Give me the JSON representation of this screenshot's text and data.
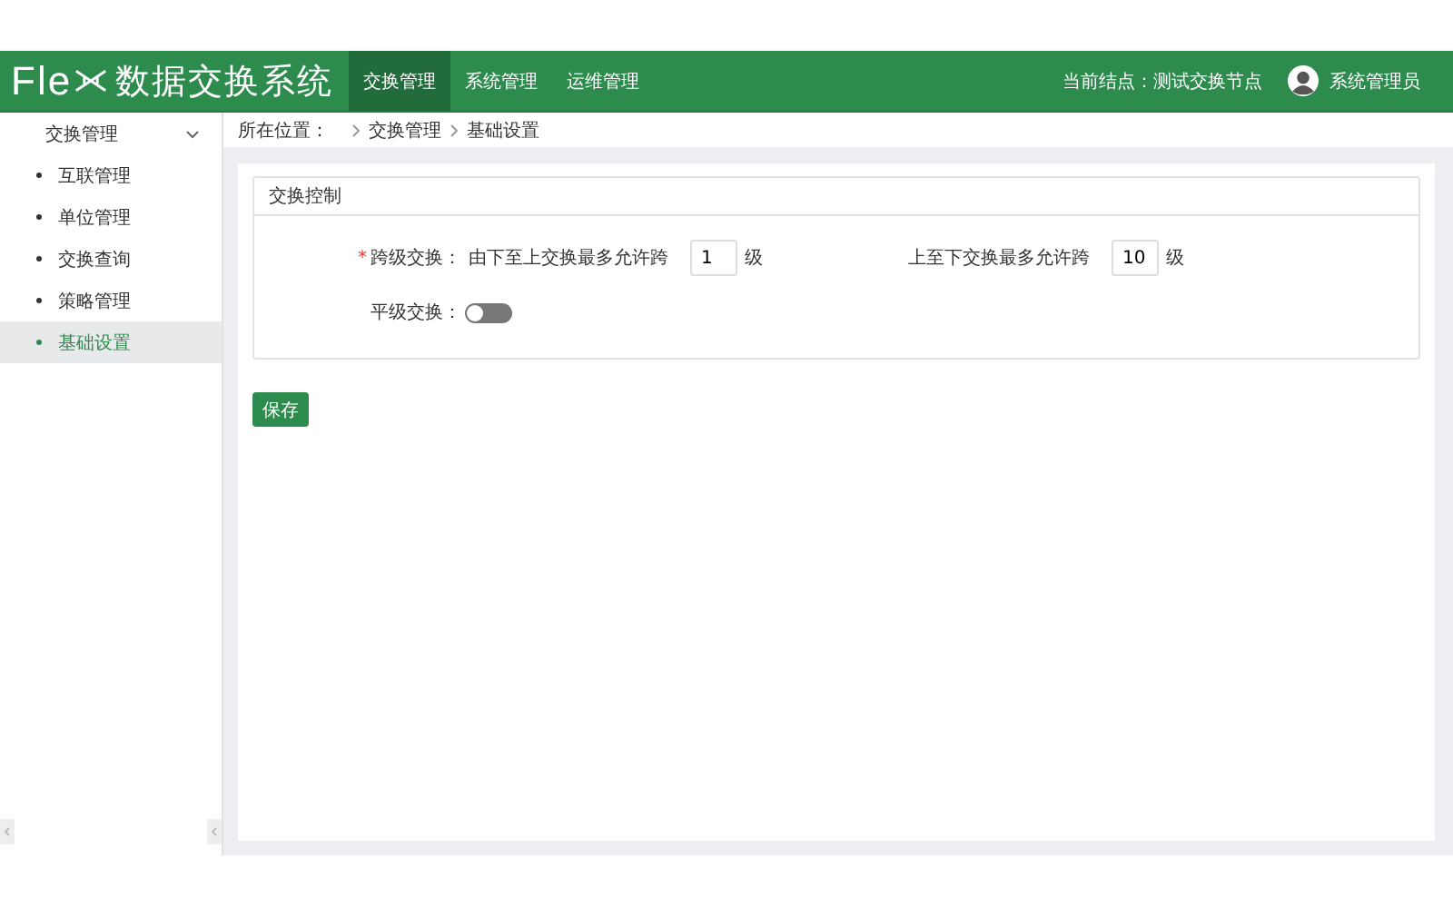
{
  "header": {
    "logo_text": "Fle",
    "system_name": "数据交换系统",
    "nav": [
      {
        "label": "交换管理",
        "selected": true
      },
      {
        "label": "系统管理",
        "selected": false
      },
      {
        "label": "运维管理",
        "selected": false
      }
    ],
    "node_label": "当前结点：测试交换节点",
    "user": "系统管理员"
  },
  "sidebar": {
    "group": {
      "label": "交换管理",
      "expanded": true
    },
    "items": [
      {
        "label": "互联管理",
        "selected": false
      },
      {
        "label": "单位管理",
        "selected": false
      },
      {
        "label": "交换查询",
        "selected": false
      },
      {
        "label": "策略管理",
        "selected": false
      },
      {
        "label": "基础设置",
        "selected": true
      }
    ]
  },
  "breadcrumb": {
    "label": "所在位置：",
    "path": [
      "交换管理",
      "基础设置"
    ]
  },
  "section": {
    "title": "交换控制",
    "fields": [
      {
        "kind": "levels",
        "required_mark": "*",
        "label": "跨级交换：",
        "parts": [
          {
            "text": "由下至上交换最多允许跨",
            "value": "1",
            "unit": "级"
          },
          {
            "text": "上至下交换最多允许跨",
            "value": "10",
            "unit": "级"
          }
        ]
      },
      {
        "kind": "switch",
        "label": "平级交换：",
        "on": false
      }
    ]
  },
  "save_button": "保存"
}
